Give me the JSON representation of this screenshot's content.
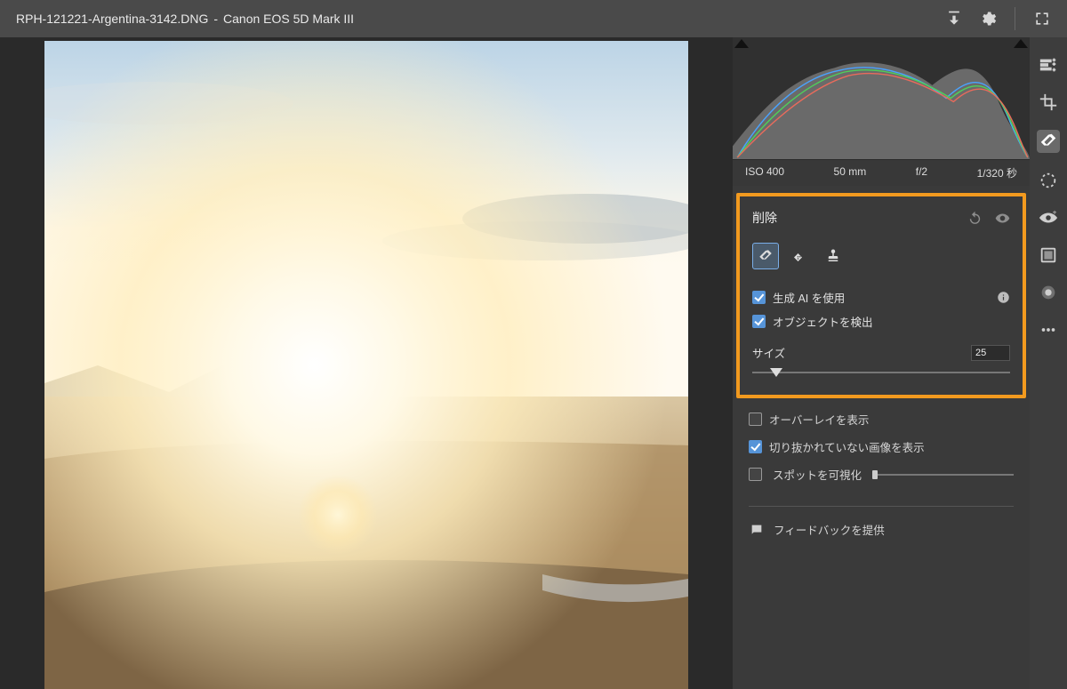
{
  "topbar": {
    "file_name": "RPH-121221-Argentina-3142.DNG",
    "separator": "  -  ",
    "camera": "Canon EOS 5D Mark III"
  },
  "metadata": {
    "iso": "ISO 400",
    "focal": "50 mm",
    "aperture": "f/2",
    "shutter": "1/320 秒"
  },
  "panel": {
    "title": "削除",
    "use_gen_ai": "生成 AI を使用",
    "detect_objects": "オブジェクトを検出",
    "size_label": "サイズ",
    "size_value": "25"
  },
  "options": {
    "show_overlay": "オーバーレイを表示",
    "show_uncropped": "切り抜かれていない画像を表示",
    "visualize_spots": "スポットを可視化",
    "feedback": "フィードバックを提供"
  }
}
